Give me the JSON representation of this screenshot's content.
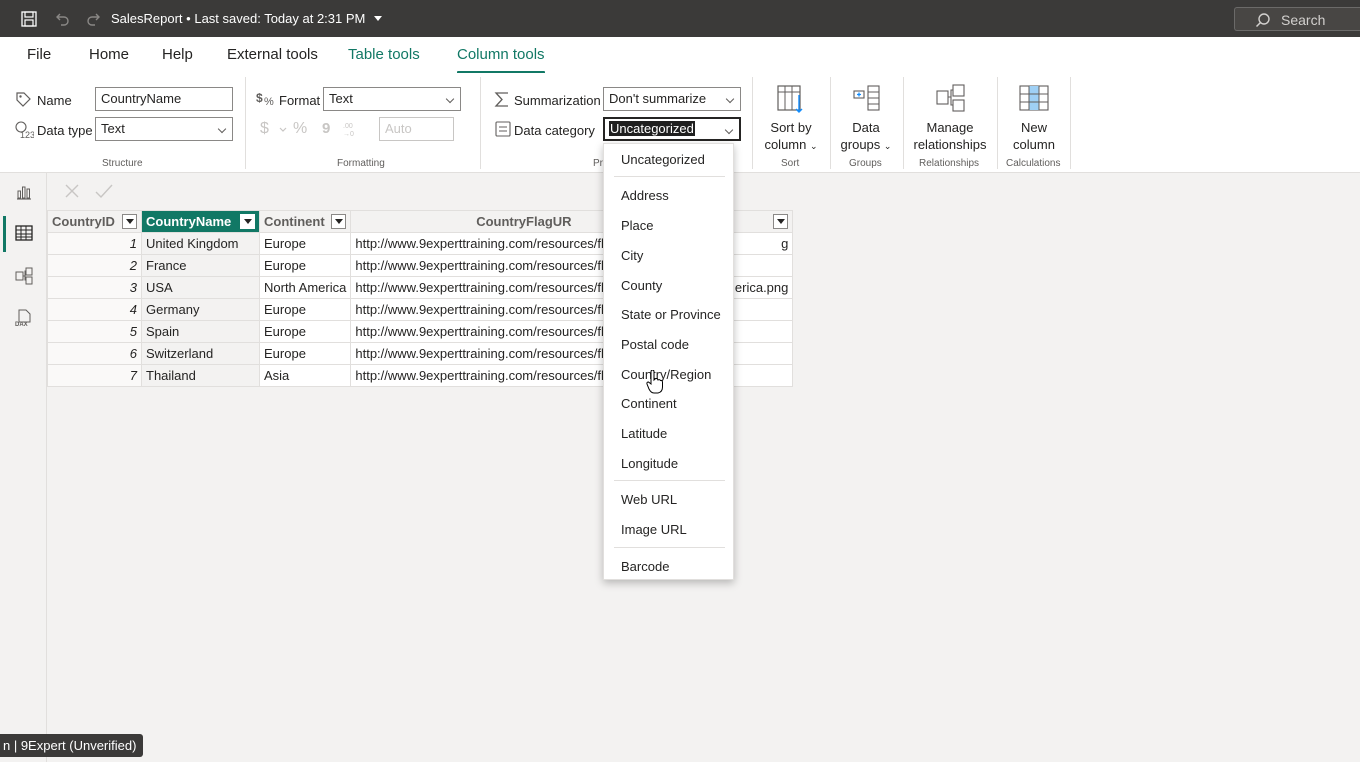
{
  "titlebar": {
    "doc_name": "SalesReport",
    "saved_text": "• Last saved: Today at 2:31 PM",
    "search_label": "Search"
  },
  "tabs": [
    {
      "label": "File"
    },
    {
      "label": "Home"
    },
    {
      "label": "Help"
    },
    {
      "label": "External tools"
    },
    {
      "label": "Table tools"
    },
    {
      "label": "Column tools"
    }
  ],
  "ribbon": {
    "structure": {
      "name_label": "Name",
      "name_value": "CountryName",
      "datatype_label": "Data type",
      "datatype_value": "Text",
      "group_label": "Structure"
    },
    "formatting": {
      "format_label": "Format",
      "format_value": "Text",
      "currency_symbol": "$",
      "percent_symbol": "%",
      "comma_symbol": "9",
      "decimals_placeholder": "Auto",
      "group_label": "Formatting"
    },
    "properties": {
      "summarization_label": "Summarization",
      "summarization_value": "Don't summarize",
      "datacategory_label": "Data category",
      "datacategory_value": "Uncategorized",
      "group_label": "Pr"
    },
    "sort": {
      "label_line1": "Sort by",
      "label_line2": "column",
      "group_label": "Sort"
    },
    "groups": {
      "label_line1": "Data",
      "label_line2": "groups",
      "group_label": "Groups"
    },
    "relationships": {
      "label_line1": "Manage",
      "label_line2": "relationships",
      "group_label": "Relationships"
    },
    "calculations": {
      "label_line1": "New",
      "label_line2": "column",
      "group_label": "Calculations"
    }
  },
  "table": {
    "columns": [
      "CountryID",
      "CountryName",
      "Continent",
      "CountryFlagUR"
    ],
    "rows": [
      {
        "id": "1",
        "name": "United Kingdom",
        "continent": "Europe",
        "url": "http://www.9experttraining.com/resources/fl",
        "url_tail": "g"
      },
      {
        "id": "2",
        "name": "France",
        "continent": "Europe",
        "url": "http://www.9experttraining.com/resources/fl",
        "url_tail": ""
      },
      {
        "id": "3",
        "name": "USA",
        "continent": "North America",
        "url": "http://www.9experttraining.com/resources/fl",
        "url_tail": "erica.png"
      },
      {
        "id": "4",
        "name": "Germany",
        "continent": "Europe",
        "url": "http://www.9experttraining.com/resources/fl",
        "url_tail": ""
      },
      {
        "id": "5",
        "name": "Spain",
        "continent": "Europe",
        "url": "http://www.9experttraining.com/resources/fl",
        "url_tail": ""
      },
      {
        "id": "6",
        "name": "Switzerland",
        "continent": "Europe",
        "url": "http://www.9experttraining.com/resources/fl",
        "url_tail": ""
      },
      {
        "id": "7",
        "name": "Thailand",
        "continent": "Asia",
        "url": "http://www.9experttraining.com/resources/fl",
        "url_tail": ""
      }
    ]
  },
  "dropdown": {
    "items": [
      "Uncategorized",
      "Address",
      "Place",
      "City",
      "County",
      "State or Province",
      "Postal code",
      "Country/Region",
      "Continent",
      "Latitude",
      "Longitude",
      "Web URL",
      "Image URL",
      "Barcode"
    ]
  },
  "status": {
    "text": "n | 9Expert (Unverified)"
  },
  "colors": {
    "accent": "#117865",
    "titlebar": "#3b3a39"
  }
}
